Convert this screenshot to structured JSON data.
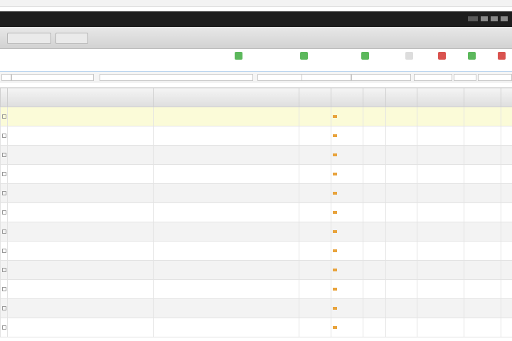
{
  "browser": {
    "url": ""
  },
  "app": {
    "title": ""
  },
  "nav": {
    "buttons": [
      "",
      ""
    ]
  },
  "toolbar": {
    "left_label": "",
    "buttons": [
      {
        "label": "",
        "color": "#5cb85c"
      },
      {
        "label": "",
        "color": "#5cb85c"
      },
      {
        "label": "",
        "color": "#5cb85c"
      },
      {
        "label": "",
        "color": "#dddddd"
      },
      {
        "label": "",
        "color": "#d9534f"
      },
      {
        "label": "",
        "color": "#5cb85c"
      },
      {
        "label": "",
        "color": "#d9534f"
      }
    ]
  },
  "filters": {
    "count_text": ""
  },
  "table": {
    "columns": [
      "",
      "",
      "",
      "",
      "",
      "",
      "",
      "",
      "",
      ""
    ],
    "rows": [
      {
        "id": "1",
        "style": "hl"
      },
      {
        "id": "2",
        "style": "odd"
      },
      {
        "id": "3",
        "style": "even"
      },
      {
        "id": "4",
        "style": "odd"
      },
      {
        "id": "5",
        "style": "even"
      },
      {
        "id": "6",
        "style": "odd"
      },
      {
        "id": "7",
        "style": "even"
      },
      {
        "id": "8",
        "style": "odd"
      },
      {
        "id": "9",
        "style": "even"
      },
      {
        "id": "10",
        "style": "odd"
      },
      {
        "id": "11",
        "style": "even"
      },
      {
        "id": "12",
        "style": "odd"
      }
    ]
  }
}
